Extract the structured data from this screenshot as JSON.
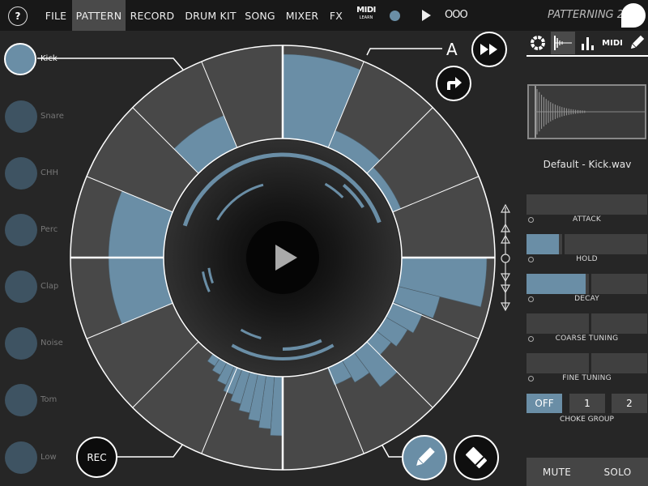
{
  "topbar": {
    "help_label": "?",
    "menu": [
      {
        "label": "FILE",
        "active": false
      },
      {
        "label": "PATTERN",
        "active": true
      },
      {
        "label": "RECORD",
        "active": false
      },
      {
        "label": "DRUM KIT",
        "active": false
      },
      {
        "label": "SONG",
        "active": false
      },
      {
        "label": "MIXER",
        "active": false
      },
      {
        "label": "FX",
        "active": false
      }
    ],
    "midi_learn_top": "MIDI",
    "midi_learn_bottom": "LEARN",
    "more_label": "OOO",
    "app_title": "PATTERNING 2"
  },
  "tracks": [
    {
      "label": "Kick",
      "selected": true
    },
    {
      "label": "Snare",
      "selected": false
    },
    {
      "label": "CHH",
      "selected": false
    },
    {
      "label": "Perc",
      "selected": false
    },
    {
      "label": "Clap",
      "selected": false
    },
    {
      "label": "Noise",
      "selected": false
    },
    {
      "label": "Tom",
      "selected": false
    },
    {
      "label": "Low",
      "selected": false
    }
  ],
  "pattern": {
    "label": "A",
    "rec_label": "REC",
    "steps": 16
  },
  "right_panel": {
    "tabs": [
      "ring-icon",
      "waveform-icon",
      "bars-icon",
      "midi-icon",
      "pencil-icon"
    ],
    "tab_midi_label": "MIDI",
    "active_tab": 1,
    "sample_name": "Default - Kick.wav",
    "params": [
      {
        "label": "ATTACK",
        "value": 0.0
      },
      {
        "label": "HOLD",
        "value": 0.27
      },
      {
        "label": "DECAY",
        "value": 0.49
      },
      {
        "label": "COARSE TUNING",
        "value": 0.0
      },
      {
        "label": "FINE TUNING",
        "value": 0.0
      }
    ],
    "choke_group": {
      "label": "CHOKE GROUP",
      "options": [
        "OFF",
        "1",
        "2"
      ],
      "selected": 0
    },
    "mute_label": "MUTE",
    "solo_label": "SOLO"
  },
  "colors": {
    "accent": "#6a8ea6",
    "segment": "#484848",
    "background": "#262626"
  }
}
